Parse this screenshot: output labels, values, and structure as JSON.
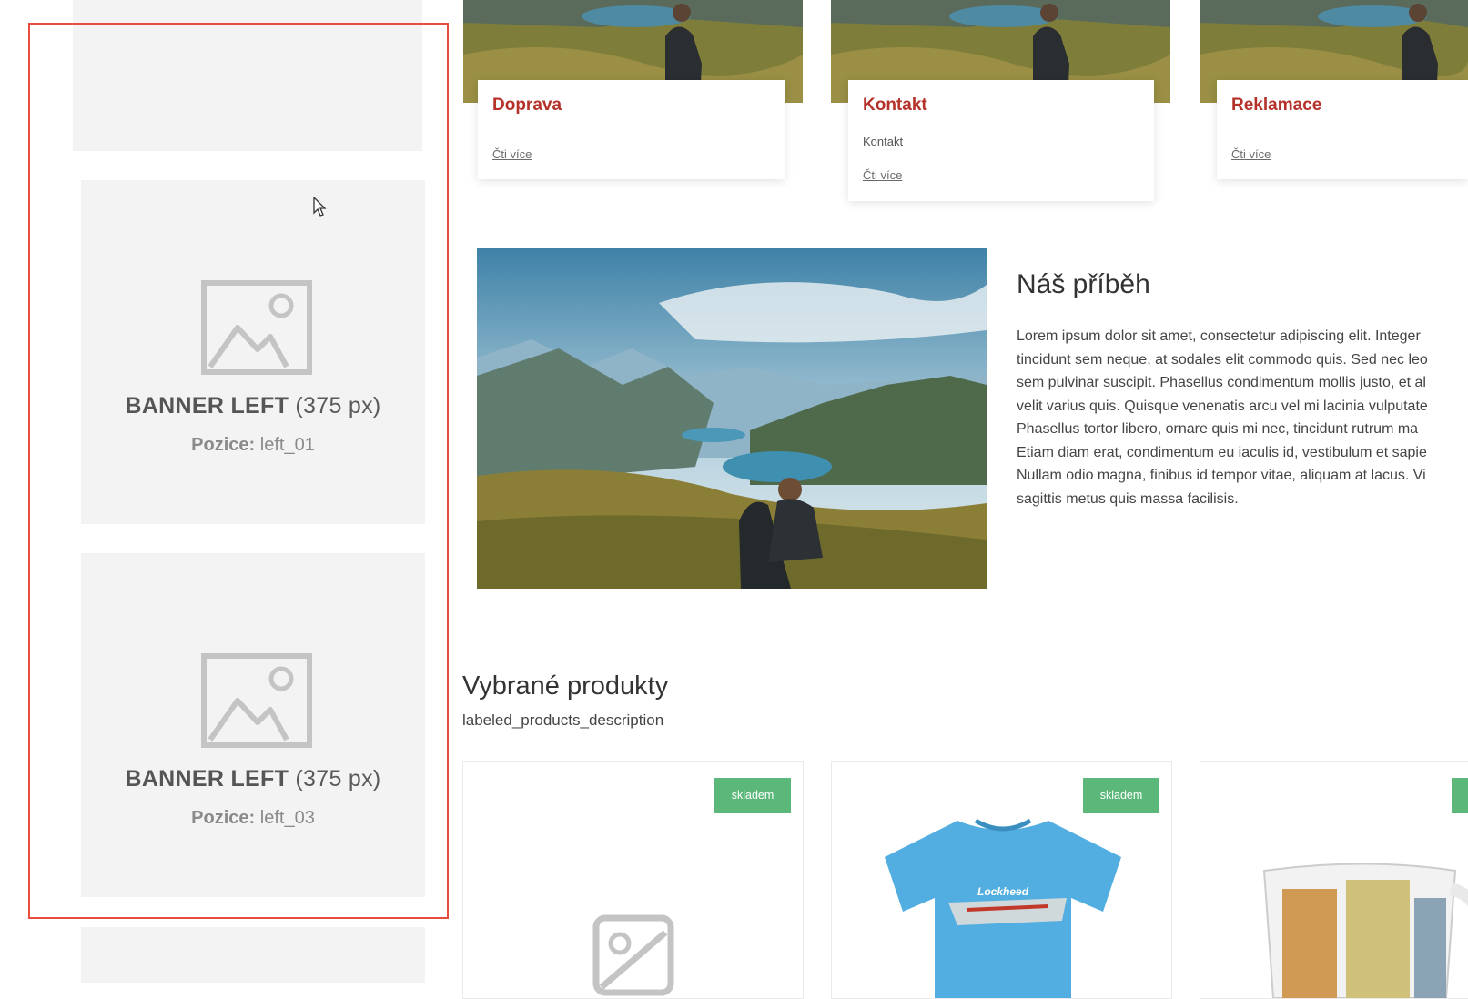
{
  "sidebar": {
    "banners": [
      {
        "title_bold": "BANNER LEFT",
        "title_size": "(375 px)",
        "position_label": "Pozice:",
        "position_value": "left_01"
      },
      {
        "title_bold": "BANNER LEFT",
        "title_size": "(375 px)",
        "position_label": "Pozice:",
        "position_value": "left_03"
      }
    ]
  },
  "info_cards": [
    {
      "title": "Doprava",
      "subtitle": "",
      "link": "Čti více"
    },
    {
      "title": "Kontakt",
      "subtitle": "Kontakt",
      "link": "Čti více"
    },
    {
      "title": "Reklamace",
      "subtitle": "",
      "link": "Čti více"
    }
  ],
  "story": {
    "title": "Náš příběh",
    "lines": [
      "Lorem ipsum dolor sit amet, consectetur adipiscing elit. Integer",
      "tincidunt sem neque, at sodales elit commodo quis. Sed nec leo",
      "sem pulvinar suscipit. Phasellus condimentum mollis justo, et al",
      "velit varius quis. Quisque venenatis arcu vel mi lacinia vulputate",
      "Phasellus tortor libero, ornare quis mi nec, tincidunt rutrum ma",
      "Etiam diam erat, condimentum eu iaculis id, vestibulum et sapie",
      "Nullam odio magna, finibus id tempor vitae, aliquam at lacus. Vi",
      "sagittis metus quis massa facilisis."
    ]
  },
  "products_section": {
    "title": "Vybrané produkty",
    "description": "labeled_products_description",
    "products": [
      {
        "badge": "skladem"
      },
      {
        "badge": "skladem"
      },
      {
        "badge": ""
      }
    ]
  },
  "colors": {
    "accent": "#b5322b",
    "badge": "#5cb87a",
    "highlight": "#e74c3c"
  },
  "icons": {
    "placeholder": "image-placeholder-icon",
    "cursor": "mouse-pointer-icon"
  }
}
